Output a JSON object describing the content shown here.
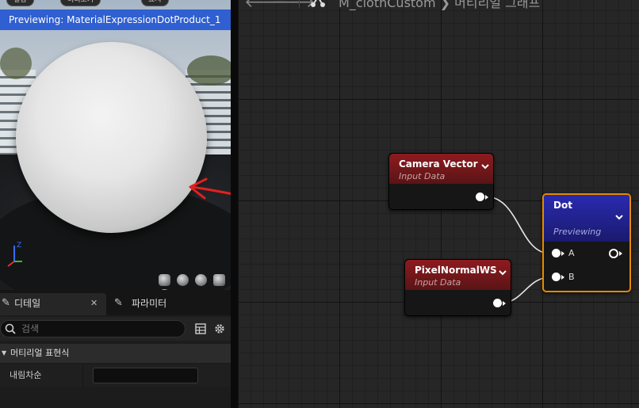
{
  "preview": {
    "top_buttons": [
      "설정",
      "미리보기",
      "표시"
    ],
    "banner": "Previewing: MaterialExpressionDotProduct_1"
  },
  "details_panel": {
    "tabs": [
      {
        "label": "디테일",
        "icon": "details-icon",
        "closable": true
      },
      {
        "label": "파라미터",
        "icon": "parameters-icon"
      }
    ],
    "search_placeholder": "검색",
    "category": "머티리얼 표현식",
    "property_label": "내림차순",
    "property_value": ""
  },
  "graph": {
    "breadcrumb": "M_clothCustom ❯ 머티리얼 그래프",
    "nodes": {
      "camera_vector": {
        "title": "Camera Vector",
        "subtitle": "Input Data"
      },
      "pixel_normal": {
        "title": "PixelNormalWS",
        "subtitle": "Input Data"
      },
      "dot": {
        "title": "Dot",
        "subtitle": "Previewing",
        "inputs": [
          "A",
          "B"
        ]
      }
    }
  },
  "colors": {
    "selection_banner": "#2f5fd0",
    "input_node_header": "#8d1b1f",
    "dot_node_header": "#2a2ab0",
    "selected_node_outline": "#e68a00",
    "annotation_arrow": "#e02020"
  }
}
